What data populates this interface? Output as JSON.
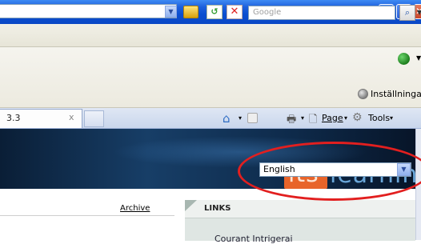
{
  "search": {
    "placeholder": "Google"
  },
  "command_bar": {
    "settings_label": "Inställningar ▾"
  },
  "tab": {
    "title": "3.3",
    "close_symbol": "x"
  },
  "toolbar": {
    "page_label": "Page",
    "tools_label": "Tools",
    "arrow": "▾"
  },
  "banner": {
    "logo_its": "its",
    "logo_learning": "learning",
    "language_selected": "English"
  },
  "content": {
    "archive_label": "Archive",
    "links_title": "LINKS",
    "links_item": "Courant Intrigerai"
  },
  "colors": {
    "highlight": "#e21f1f",
    "logo_orange": "#e8642a"
  }
}
